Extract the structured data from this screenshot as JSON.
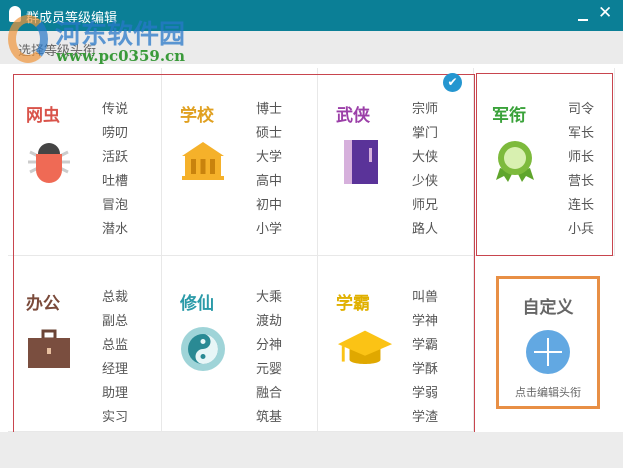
{
  "window": {
    "title": "群成员等级编辑",
    "minimize": "minimize",
    "close": "✕"
  },
  "subheader": "选择等级头衔",
  "watermark": {
    "name": "河东软件园",
    "url": "www.pc0359.cn"
  },
  "categories": [
    {
      "name": "网虫",
      "color": "#d9534a",
      "icon": "bug-icon",
      "items": [
        "传说",
        "唠叨",
        "活跃",
        "吐槽",
        "冒泡",
        "潜水"
      ]
    },
    {
      "name": "学校",
      "color": "#e0a020",
      "icon": "school-building-icon",
      "items": [
        "博士",
        "硕士",
        "大学",
        "高中",
        "初中",
        "小学"
      ]
    },
    {
      "name": "武侠",
      "color": "#9b3fa8",
      "icon": "book-icon",
      "items": [
        "宗师",
        "掌门",
        "大侠",
        "少侠",
        "师兄",
        "路人"
      ],
      "selected": true
    },
    {
      "name": "军衔",
      "color": "#3aa23a",
      "icon": "medal-icon",
      "items": [
        "司令",
        "军长",
        "师长",
        "营长",
        "连长",
        "小兵"
      ]
    },
    {
      "name": "办公",
      "color": "#7a4a3a",
      "icon": "briefcase-icon",
      "items": [
        "总裁",
        "副总",
        "总监",
        "经理",
        "助理",
        "实习"
      ]
    },
    {
      "name": "修仙",
      "color": "#2a9aa8",
      "icon": "yin-yang-icon",
      "items": [
        "大乘",
        "渡劫",
        "分神",
        "元婴",
        "融合",
        "筑基"
      ]
    },
    {
      "name": "学霸",
      "color": "#e0b000",
      "icon": "graduation-cap-icon",
      "items": [
        "叫兽",
        "学神",
        "学霸",
        "学酥",
        "学弱",
        "学渣"
      ]
    }
  ],
  "custom": {
    "title": "自定义",
    "subtitle": "点击编辑头衔",
    "icon": "plus-icon"
  }
}
